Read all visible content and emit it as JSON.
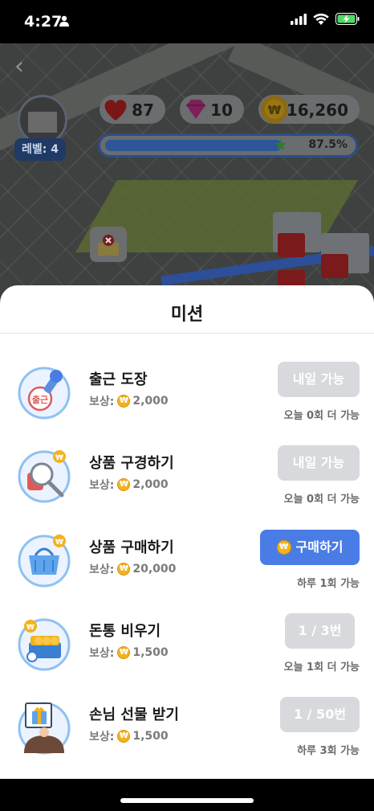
{
  "status_bar": {
    "time": "4:27"
  },
  "game": {
    "level_label": "레벨: 4",
    "hearts": "87",
    "gems": "10",
    "coins": "16,260",
    "progress_text": "87.5%",
    "progress_fraction": 0.875
  },
  "sheet": {
    "title": "미션",
    "missions": [
      {
        "name": "출근 도장",
        "reward_label": "보상:",
        "reward": "2,000",
        "button": "내일 가능",
        "limit": "오늘 0회 더 가능",
        "state": "disabled",
        "icon": "stamp-icon"
      },
      {
        "name": "상품 구경하기",
        "reward_label": "보상:",
        "reward": "2,000",
        "button": "내일 가능",
        "limit": "오늘 0회 더 가능",
        "state": "disabled",
        "icon": "magnifier-icon"
      },
      {
        "name": "상품 구매하기",
        "reward_label": "보상:",
        "reward": "20,000",
        "button": "구매하기",
        "limit": "하루 1회 가능",
        "state": "active",
        "icon": "basket-icon"
      },
      {
        "name": "돈통 비우기",
        "reward_label": "보상:",
        "reward": "1,500",
        "button": "1 / 3번",
        "limit": "오늘 1회 더 가능",
        "state": "disabled",
        "icon": "cash-box-icon"
      },
      {
        "name": "손님 선물 받기",
        "reward_label": "보상:",
        "reward": "1,500",
        "button": "1 / 50번",
        "limit": "하루 3회 가능",
        "state": "disabled",
        "icon": "gift-icon"
      }
    ]
  },
  "colors": {
    "accent": "#4a7ce6",
    "disabled_button": "#d7d9dd",
    "coin": "#f3b21e"
  }
}
